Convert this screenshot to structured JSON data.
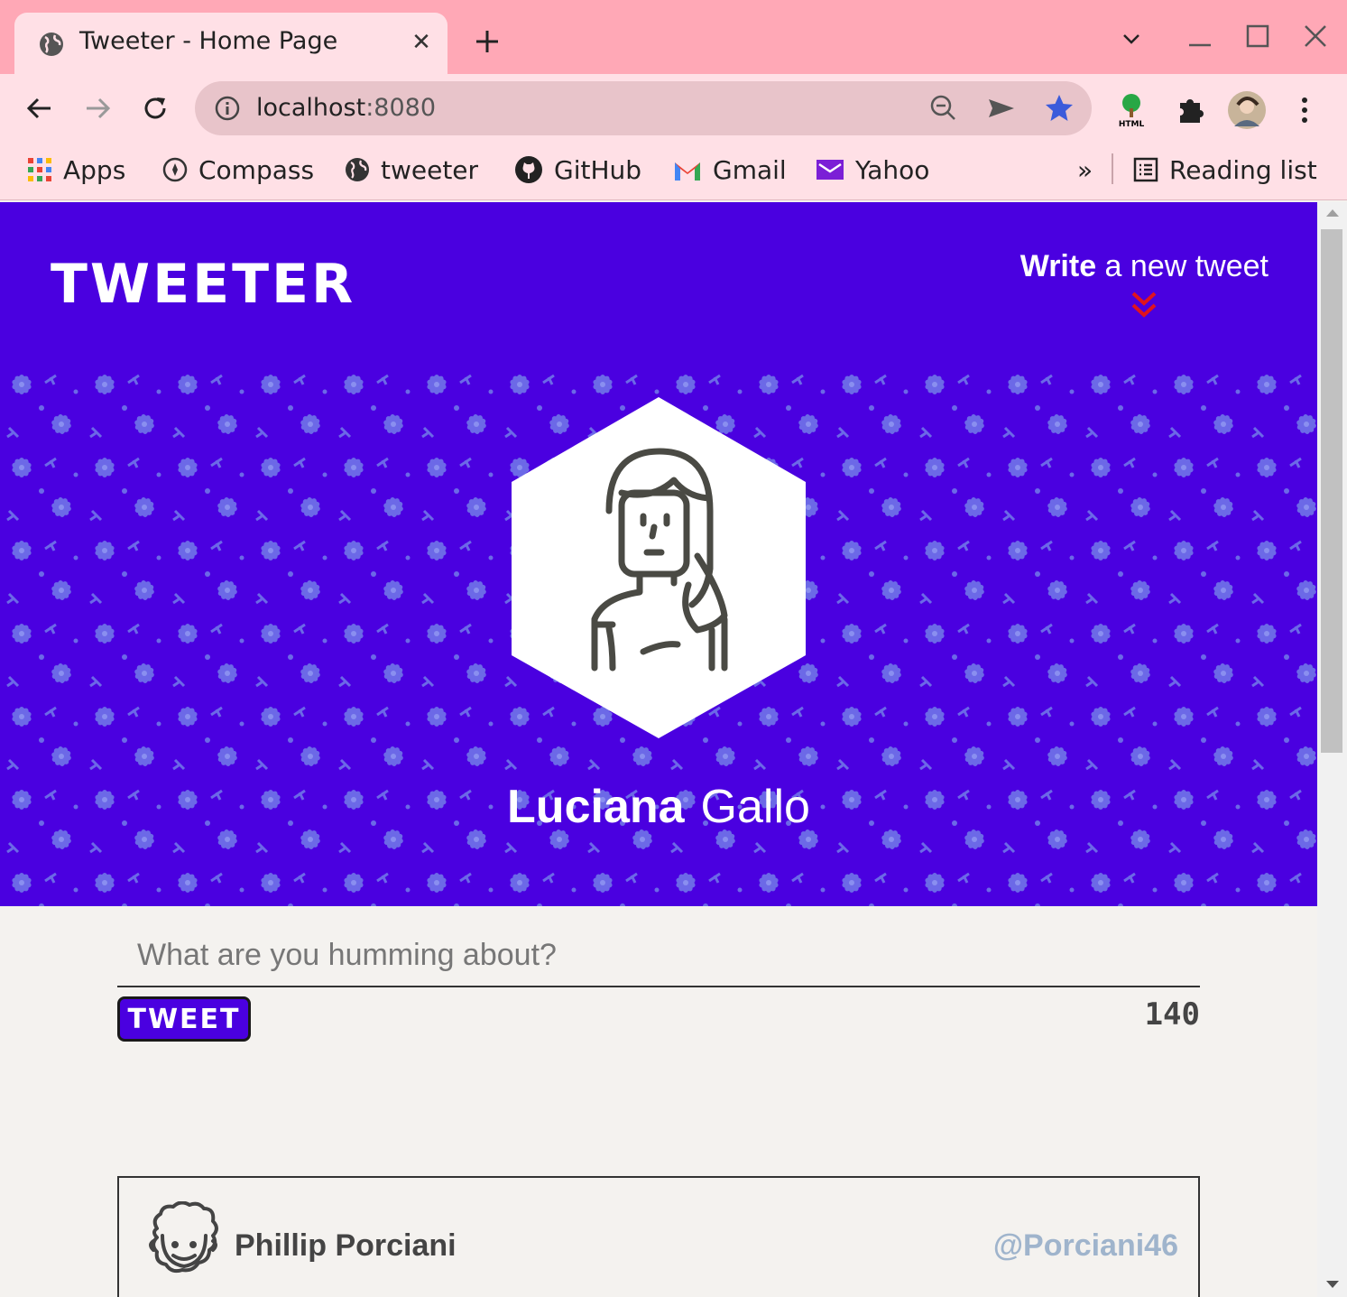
{
  "browser": {
    "tab_title": "Tweeter - Home Page",
    "tab_close": "✕",
    "url_host": "localhost",
    "url_port": ":8080",
    "bookmarks": [
      {
        "label": "Apps",
        "icon": "apps-grid-icon"
      },
      {
        "label": "Compass",
        "icon": "compass-icon"
      },
      {
        "label": "tweeter",
        "icon": "globe-icon"
      },
      {
        "label": "GitHub",
        "icon": "github-icon"
      },
      {
        "label": "Gmail",
        "icon": "gmail-icon"
      },
      {
        "label": "Yahoo",
        "icon": "yahoo-mail-icon"
      }
    ],
    "more_bookmarks": "»",
    "reading_list": "Reading list"
  },
  "colors": {
    "accent": "#4a00e0",
    "tab_strip": "#ffa8b6",
    "toolbar": "#ffe0e6",
    "arrow": "#e0141e"
  },
  "nav": {
    "brand": "TWEETER",
    "compose_bold": "Write",
    "compose_rest": " a new tweet"
  },
  "profile": {
    "first_name": "Luciana",
    "last_name": "Gallo"
  },
  "composer": {
    "placeholder": "What are you humming about?",
    "submit_label": "TWEET",
    "counter": "140"
  },
  "tweets": [
    {
      "name": "Phillip Porciani",
      "handle": "@Porciani46"
    }
  ]
}
